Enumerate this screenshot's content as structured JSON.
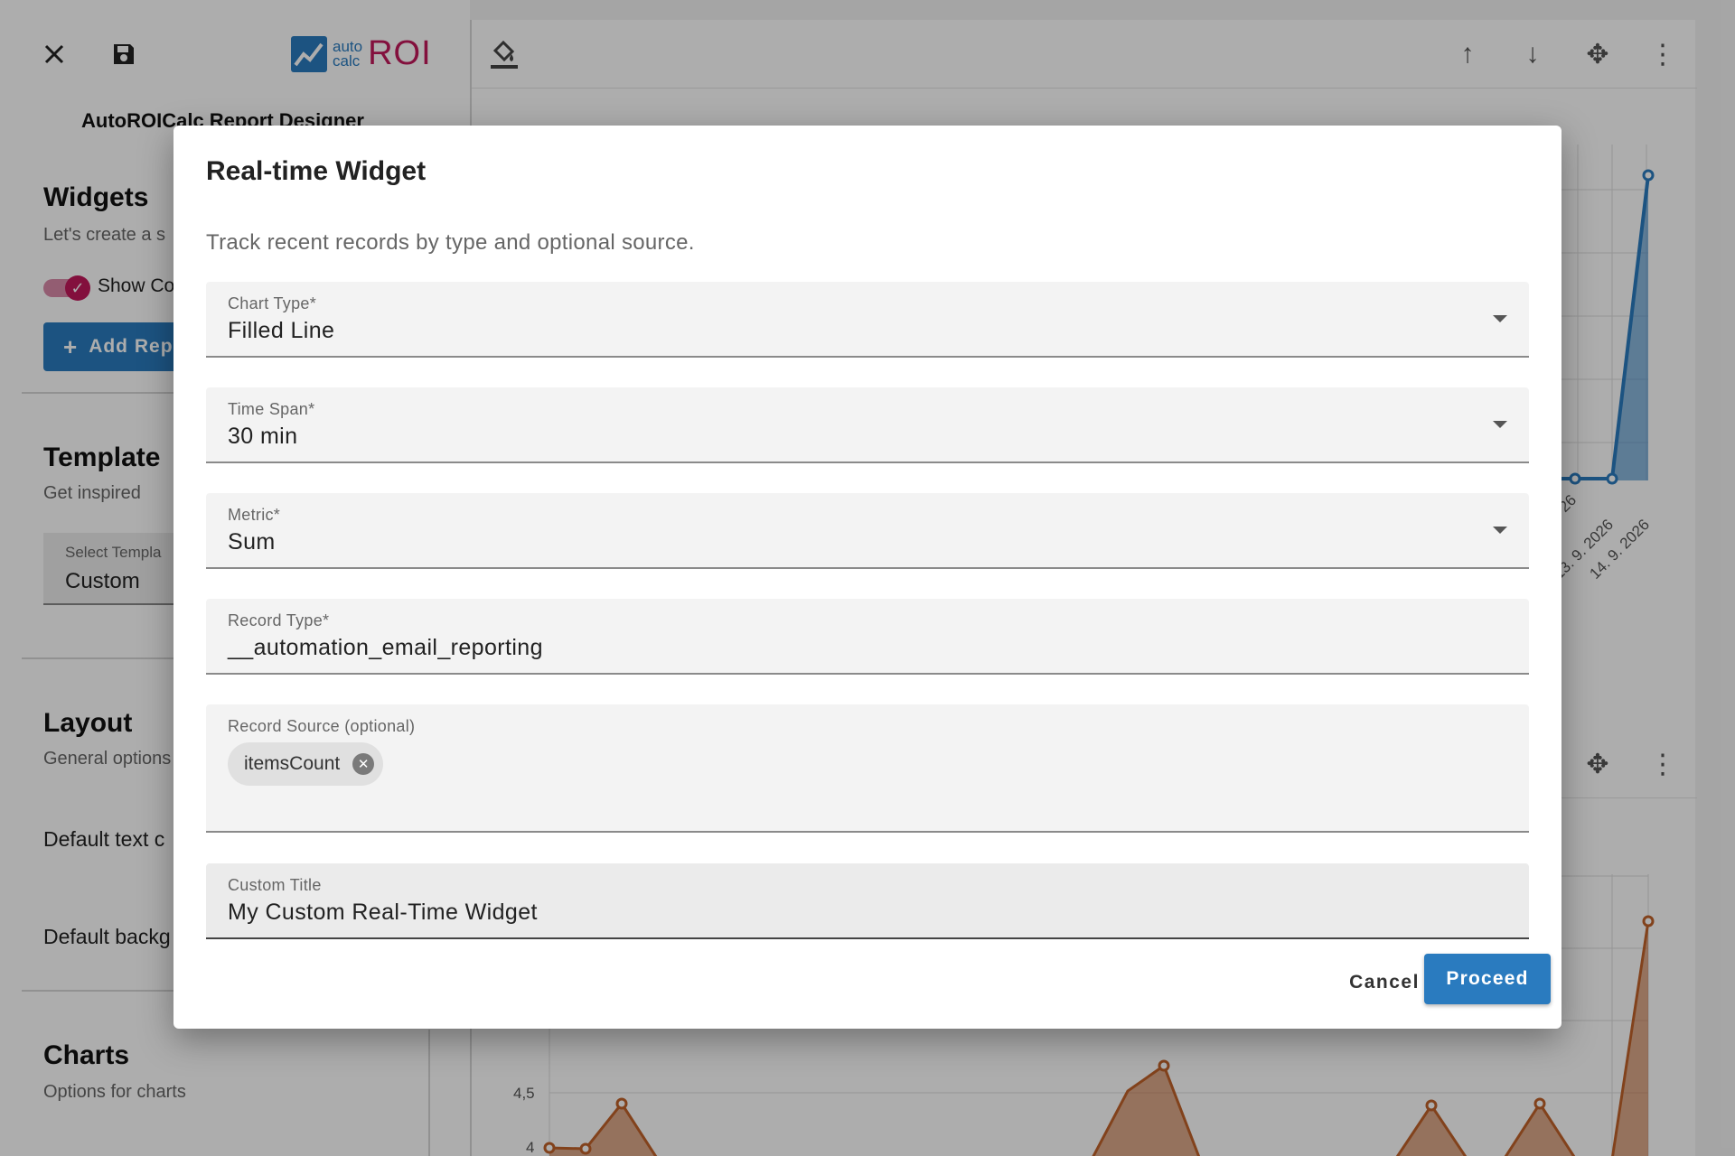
{
  "left_panel": {
    "app_logo": {
      "small_top": "auto",
      "small_bottom": "calc",
      "big": "ROI"
    },
    "designer_title": "AutoROICalc Report Designer",
    "widgets": {
      "heading": "Widgets",
      "subtitle": "Let's create a s",
      "toggle_label": "Show Co",
      "add_button": "Add Rep"
    },
    "template": {
      "heading": "Template",
      "subtitle": "Get inspired",
      "select_label": "Select Templa",
      "select_value": "Custom"
    },
    "layout": {
      "heading": "Layout",
      "subtitle": "General options",
      "option1": "Default text c",
      "option2": "Default backg"
    },
    "charts": {
      "heading": "Charts",
      "subtitle": "Options for charts"
    }
  },
  "background_charts": {
    "chart1": {
      "x_tick_labels": [
        "26",
        "13. 9. 2026",
        "14. 9. 2026"
      ]
    },
    "chart2": {
      "y_tick_labels": [
        "4,5",
        "4"
      ]
    }
  },
  "dialog": {
    "title": "Real-time Widget",
    "description": "Track recent records by type and optional source.",
    "fields": {
      "chart_type": {
        "label": "Chart Type*",
        "value": "Filled Line"
      },
      "time_span": {
        "label": "Time Span*",
        "value": "30 min"
      },
      "metric": {
        "label": "Metric*",
        "value": "Sum"
      },
      "record_type": {
        "label": "Record Type*",
        "value": "__automation_email_reporting"
      },
      "record_source": {
        "label": "Record Source (optional)",
        "chips": [
          "itemsCount"
        ]
      },
      "custom_title": {
        "label": "Custom Title",
        "value": "My Custom Real-Time Widget"
      }
    },
    "cancel_label": "Cancel",
    "proceed_label": "Proceed"
  },
  "colors": {
    "accent": "#2a7bbf",
    "toggle": "#c2185b",
    "chart_blue": "#2a7bbf",
    "chart_orange": "#c0622a"
  }
}
